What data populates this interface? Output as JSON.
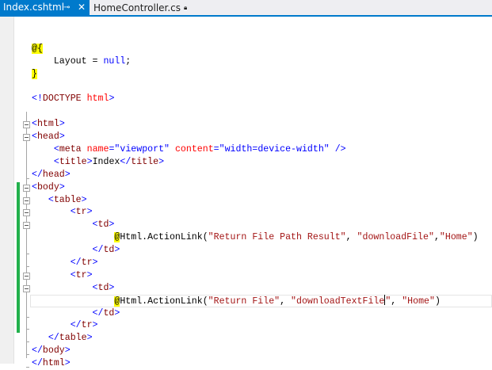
{
  "tabs": [
    {
      "label": "Index.cshtml",
      "active": true,
      "pin_icon": "pin-icon",
      "close_icon": "close-icon"
    },
    {
      "label": "HomeController.cs",
      "icon": "lock-icon"
    }
  ],
  "colors": {
    "accent": "#007acc",
    "change_bar": "#22b14c"
  },
  "code": [
    {
      "fold": "",
      "t": []
    },
    {
      "fold": "",
      "t": [
        [
          "r",
          "@{"
        ]
      ]
    },
    {
      "fold": "",
      "t": [
        [
          "p",
          "    Layout = "
        ],
        [
          "k",
          "null"
        ],
        [
          "p",
          ";"
        ]
      ]
    },
    {
      "fold": "",
      "t": [
        [
          "r",
          "}"
        ]
      ]
    },
    {
      "fold": "",
      "t": []
    },
    {
      "fold": "",
      "t": [
        [
          "d",
          "<!"
        ],
        [
          "n",
          "DOCTYPE "
        ],
        [
          "a",
          "html"
        ],
        [
          "d",
          ">"
        ]
      ]
    },
    {
      "fold": "",
      "t": []
    },
    {
      "fold": "box",
      "t": [
        [
          "d",
          "<"
        ],
        [
          "n",
          "html"
        ],
        [
          "d",
          ">"
        ]
      ]
    },
    {
      "fold": "box",
      "t": [
        [
          "d",
          "<"
        ],
        [
          "n",
          "head"
        ],
        [
          "d",
          ">"
        ]
      ]
    },
    {
      "fold": "",
      "t": [
        [
          "p",
          "    "
        ],
        [
          "d",
          "<"
        ],
        [
          "n",
          "meta "
        ],
        [
          "a",
          "name"
        ],
        [
          "d",
          "=\"viewport\" "
        ],
        [
          "a",
          "content"
        ],
        [
          "d",
          "=\"width=device-width\" />"
        ]
      ]
    },
    {
      "fold": "",
      "t": [
        [
          "p",
          "    "
        ],
        [
          "d",
          "<"
        ],
        [
          "n",
          "title"
        ],
        [
          "d",
          ">"
        ],
        [
          "p",
          "Index"
        ],
        [
          "d",
          "</"
        ],
        [
          "n",
          "title"
        ],
        [
          "d",
          ">"
        ]
      ]
    },
    {
      "fold": "end",
      "t": [
        [
          "d",
          "</"
        ],
        [
          "n",
          "head"
        ],
        [
          "d",
          ">"
        ]
      ]
    },
    {
      "fold": "box",
      "t": [
        [
          "d",
          "<"
        ],
        [
          "n",
          "body"
        ],
        [
          "d",
          ">"
        ]
      ]
    },
    {
      "fold": "box",
      "t": [
        [
          "p",
          "   "
        ],
        [
          "d",
          "<"
        ],
        [
          "n",
          "table"
        ],
        [
          "d",
          ">"
        ]
      ]
    },
    {
      "fold": "box",
      "t": [
        [
          "p",
          "       "
        ],
        [
          "d",
          "<"
        ],
        [
          "n",
          "tr"
        ],
        [
          "d",
          ">"
        ]
      ]
    },
    {
      "fold": "box",
      "t": [
        [
          "p",
          "           "
        ],
        [
          "d",
          "<"
        ],
        [
          "n",
          "td"
        ],
        [
          "d",
          ">"
        ]
      ]
    },
    {
      "fold": "",
      "t": [
        [
          "p",
          "               "
        ],
        [
          "r",
          "@"
        ],
        [
          "p",
          "Html.ActionLink("
        ],
        [
          "s",
          "\"Return File Path Result\""
        ],
        [
          "p",
          ", "
        ],
        [
          "s",
          "\"downloadFile\""
        ],
        [
          "p",
          ","
        ],
        [
          "s",
          "\"Home\""
        ],
        [
          "p",
          ")"
        ]
      ]
    },
    {
      "fold": "end",
      "t": [
        [
          "p",
          "           "
        ],
        [
          "d",
          "</"
        ],
        [
          "n",
          "td"
        ],
        [
          "d",
          ">"
        ]
      ]
    },
    {
      "fold": "end",
      "t": [
        [
          "p",
          "       "
        ],
        [
          "d",
          "</"
        ],
        [
          "n",
          "tr"
        ],
        [
          "d",
          ">"
        ]
      ]
    },
    {
      "fold": "box",
      "t": [
        [
          "p",
          "       "
        ],
        [
          "d",
          "<"
        ],
        [
          "n",
          "tr"
        ],
        [
          "d",
          ">"
        ]
      ]
    },
    {
      "fold": "box",
      "t": [
        [
          "p",
          "           "
        ],
        [
          "d",
          "<"
        ],
        [
          "n",
          "td"
        ],
        [
          "d",
          ">"
        ]
      ]
    },
    {
      "fold": "cur",
      "t": [
        [
          "p",
          "               "
        ],
        [
          "r",
          "@"
        ],
        [
          "p",
          "Html.ActionLink("
        ],
        [
          "s",
          "\"Return File\""
        ],
        [
          "p",
          ", "
        ],
        [
          "s",
          "\"downloadTextFile"
        ],
        [
          "caret",
          ""
        ],
        [
          "s",
          "\""
        ],
        [
          "p",
          ", "
        ],
        [
          "s",
          "\"Home\""
        ],
        [
          "p",
          ")"
        ]
      ]
    },
    {
      "fold": "end",
      "t": [
        [
          "p",
          "           "
        ],
        [
          "d",
          "</"
        ],
        [
          "n",
          "td"
        ],
        [
          "d",
          ">"
        ]
      ]
    },
    {
      "fold": "end",
      "t": [
        [
          "p",
          "       "
        ],
        [
          "d",
          "</"
        ],
        [
          "n",
          "tr"
        ],
        [
          "d",
          ">"
        ]
      ]
    },
    {
      "fold": "end",
      "t": [
        [
          "p",
          "   "
        ],
        [
          "d",
          "</"
        ],
        [
          "n",
          "table"
        ],
        [
          "d",
          ">"
        ]
      ]
    },
    {
      "fold": "end",
      "t": [
        [
          "d",
          "</"
        ],
        [
          "n",
          "body"
        ],
        [
          "d",
          ">"
        ]
      ]
    },
    {
      "fold": "end",
      "t": [
        [
          "d",
          "</"
        ],
        [
          "n",
          "html"
        ],
        [
          "d",
          ">"
        ]
      ]
    }
  ]
}
